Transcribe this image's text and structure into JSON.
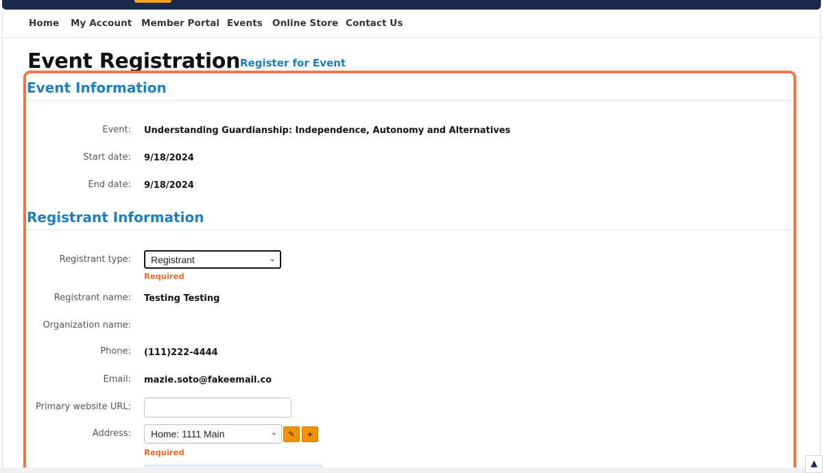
{
  "nav": {
    "items": [
      "Home",
      "My Account",
      "Member Portal",
      "Events",
      "Online Store",
      "Contact Us"
    ]
  },
  "header": {
    "title": "Event Registration",
    "separator": "|",
    "subtitle_link": "Register for Event"
  },
  "event_info": {
    "heading": "Event Information",
    "rows": [
      {
        "label": "Event:",
        "value": "Understanding Guardianship: Independence, Autonomy and Alternatives"
      },
      {
        "label": "Start date:",
        "value": "9/18/2024"
      },
      {
        "label": "End date:",
        "value": "9/18/2024"
      }
    ]
  },
  "registrant_info": {
    "heading": "Registrant Information",
    "registrant_type": {
      "label": "Registrant type:",
      "selected": "Registrant",
      "required_text": "Required"
    },
    "registrant_name": {
      "label": "Registrant name:",
      "value": "Testing Testing"
    },
    "organization_name": {
      "label": "Organization name:",
      "value": ""
    },
    "phone": {
      "label": "Phone:",
      "value": "(111)222-4444"
    },
    "email": {
      "label": "Email:",
      "value": "mazie.soto@fakeemail.co"
    },
    "website": {
      "label": "Primary website URL:",
      "value": ""
    },
    "address": {
      "label": "Address:",
      "selected": "Home: 1111 Main",
      "required_text": "Required"
    }
  },
  "icons": {
    "edit": "pencil-icon",
    "add": "plus-icon",
    "scroll_top": "chevron-up-icon",
    "dropdown": "chevron-down-icon"
  },
  "colors": {
    "brand_navy": "#1b2a4a",
    "heading_blue": "#1e7ec2",
    "link_blue": "#1b7bbf",
    "highlight_orange": "#f07744",
    "required_orange": "#f06a25",
    "button_orange": "#f39200"
  }
}
